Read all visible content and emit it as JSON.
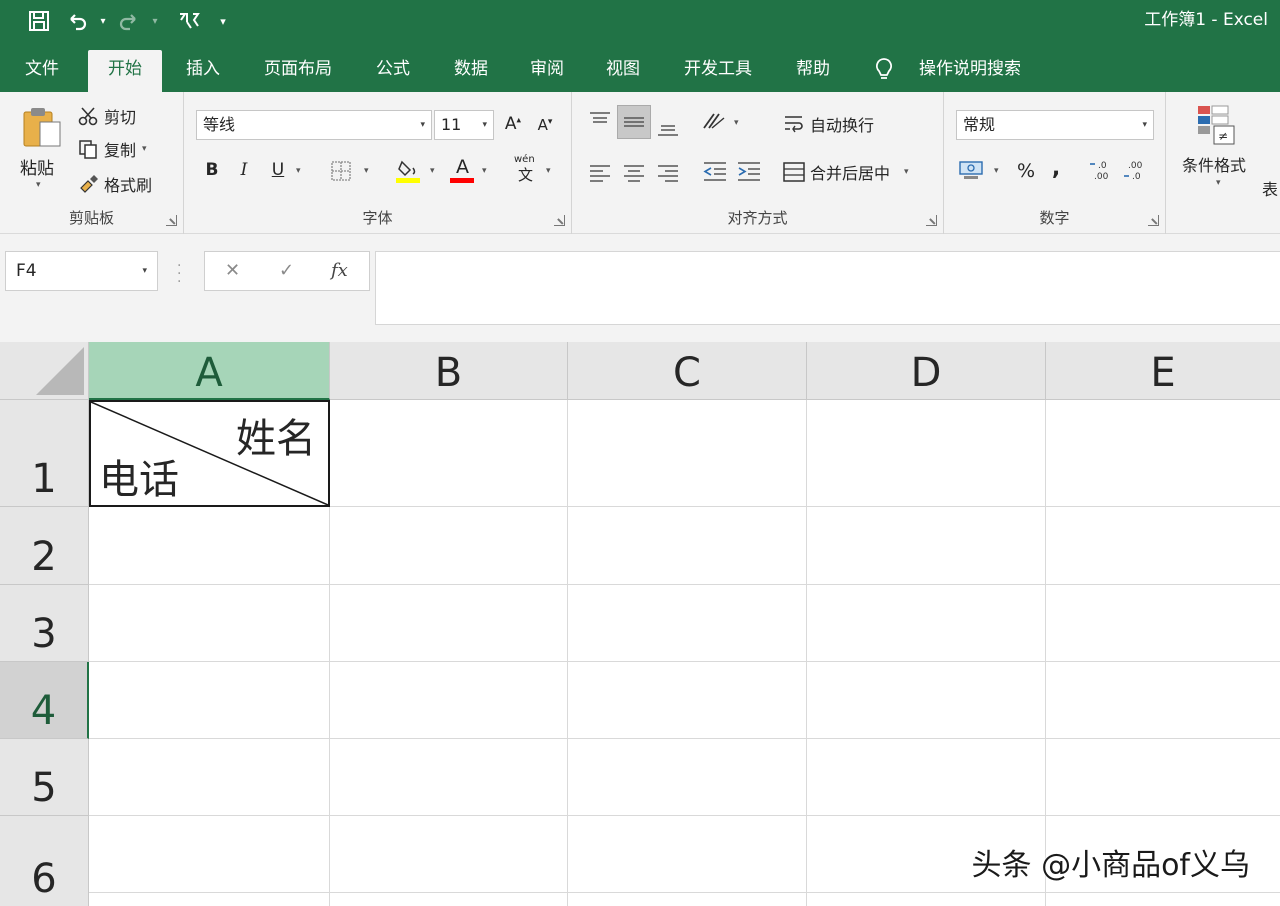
{
  "app": {
    "title": "工作簿1 - Excel"
  },
  "qat": {
    "items": [
      "save-icon",
      "undo-icon",
      "redo-icon",
      "touch-mode-icon",
      "customize-icon"
    ]
  },
  "tabs": [
    "文件",
    "开始",
    "插入",
    "页面布局",
    "公式",
    "数据",
    "审阅",
    "视图",
    "开发工具",
    "帮助"
  ],
  "active_tab": "开始",
  "tell_me": "操作说明搜索",
  "ribbon": {
    "clipboard": {
      "label": "剪贴板",
      "paste": "粘贴",
      "cut": "剪切",
      "copy": "复制",
      "format_painter": "格式刷"
    },
    "font": {
      "label": "字体",
      "font_name": "等线",
      "font_size": "11",
      "grow": "A",
      "shrink": "A",
      "bold": "B",
      "italic": "I",
      "underline": "U",
      "font_color_letter": "A",
      "phonetic": "wén"
    },
    "alignment": {
      "label": "对齐方式",
      "wrap_text": "自动换行",
      "merge_center": "合并后居中"
    },
    "number": {
      "label": "数字",
      "format": "常规",
      "percent": "%",
      "comma": ","
    },
    "styles": {
      "conditional": "条件格式",
      "table_partial": "表"
    }
  },
  "formula_bar": {
    "name_box": "F4",
    "fx": "fx",
    "cancel": "✕",
    "enter": "✓",
    "value": ""
  },
  "grid": {
    "columns": [
      "A",
      "B",
      "C",
      "D",
      "E"
    ],
    "rows": [
      "1",
      "2",
      "3",
      "4",
      "5",
      "6"
    ],
    "selected_column": "A",
    "selected_row": "4",
    "cell_a1": {
      "top_right": "姓名",
      "bottom_left": "电话"
    }
  },
  "watermark": "头条 @小商品of义乌",
  "colors": {
    "accent": "#217346",
    "selected_header": "#a6d5b8",
    "highlight_yellow": "#ffff00",
    "font_red": "#ff0000"
  }
}
